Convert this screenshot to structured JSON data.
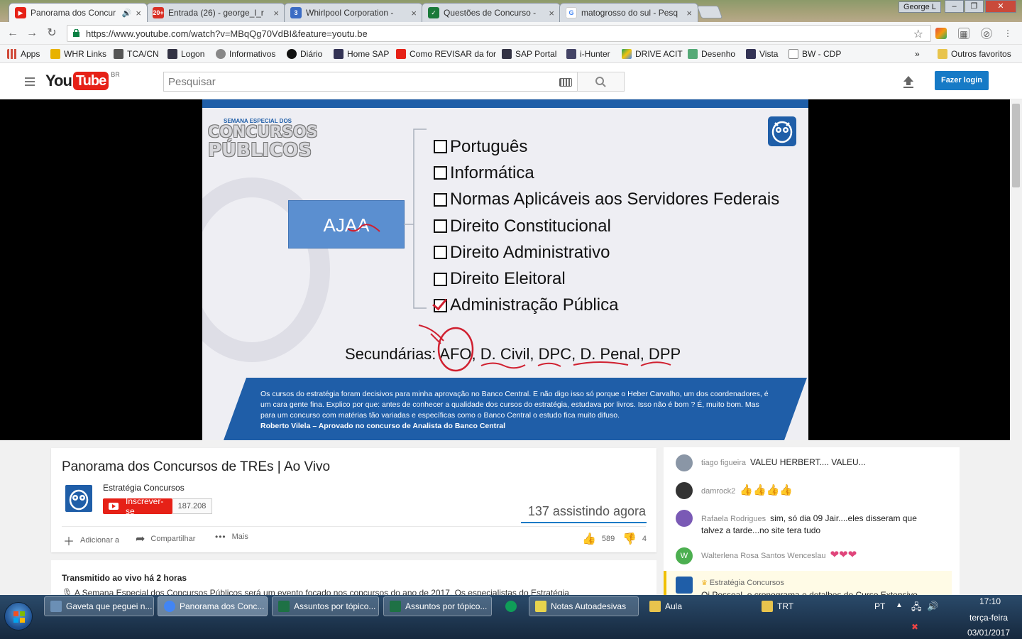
{
  "browser": {
    "tabs": [
      {
        "title": "Panorama dos Concur",
        "active": true,
        "favicon": "youtube-icon",
        "color": "#e62117"
      },
      {
        "title": "Entrada (26) - george_l_r",
        "favicon": "gmail-icon",
        "color": "#d93025",
        "badge": "20+"
      },
      {
        "title": "Whirlpool Corporation -",
        "favicon": "doc-icon",
        "color": "#3b6cc4",
        "badge": "3"
      },
      {
        "title": "Questões de Concurso -",
        "favicon": "check-icon",
        "color": "#1a7a3a"
      },
      {
        "title": "matogrosso do sul - Pesq",
        "favicon": "google-icon",
        "color": "#4285f4"
      }
    ],
    "window_user": "George L",
    "url": "https://www.youtube.com/watch?v=MBqQg70VdBI&feature=youtu.be",
    "bookmarks": [
      {
        "label": "Apps",
        "color": "#d04a3a"
      },
      {
        "label": "WHR Links",
        "color": "#e8b200"
      },
      {
        "label": "TCA/CN",
        "color": "#444"
      },
      {
        "label": "Logon",
        "color": "#223"
      },
      {
        "label": "Informativos",
        "color": "#777"
      },
      {
        "label": "Diário",
        "color": "#111"
      },
      {
        "label": "Home SAP",
        "color": "#225"
      },
      {
        "label": "Como REVISAR da for",
        "color": "#e62117"
      },
      {
        "label": "SAP Portal",
        "color": "#223"
      },
      {
        "label": "i-Hunter",
        "color": "#335"
      },
      {
        "label": "DRIVE ACIT",
        "color": "#1aa260"
      },
      {
        "label": "Desenho",
        "color": "#4a6"
      },
      {
        "label": "Vista",
        "color": "#225"
      },
      {
        "label": "BW - CDP",
        "color": "#888"
      }
    ],
    "bookmarks_more": "»",
    "other_bookmarks": "Outros favoritos"
  },
  "youtube": {
    "logo_you": "You",
    "logo_tube": "Tube",
    "region": "BR",
    "search_placeholder": "Pesquisar",
    "login_label": "Fazer login"
  },
  "slide": {
    "badge_line1": "SEMANA ESPECIAL DOS",
    "badge_line2": "CONCURSOS",
    "badge_line3": "PÚBLICOS",
    "box_label": "AJAA",
    "subjects": [
      {
        "label": "Português",
        "checked": false
      },
      {
        "label": "Informática",
        "checked": false
      },
      {
        "label": "Normas Aplicáveis aos Servidores Federais",
        "checked": false
      },
      {
        "label": "Direito Constitucional",
        "checked": false
      },
      {
        "label": "Direito Administrativo",
        "checked": false
      },
      {
        "label": "Direito Eleitoral",
        "checked": false
      },
      {
        "label": "Administração Pública",
        "checked": true
      }
    ],
    "secondary": "Secundárias: AFO, D. Civil, DPC, D. Penal, DPP",
    "quote": "Os cursos do estratégia foram decisivos para minha aprovação no Banco Central. E não digo isso só porque o Heber Carvalho, um dos coordenadores, é um cara gente fina. Explico por que: antes de conhecer a qualidade dos cursos do estratégia, estudava por livros. Isso não é bom ? É, muito bom. Mas para um concurso com matérias tão variadas e específicas como o Banco Central o estudo fica muito difuso.",
    "quote_author": "Roberto Vilela – Aprovado no concurso de Analista do Banco Central"
  },
  "video": {
    "title": "Panorama dos Concursos de TREs | Ao Vivo",
    "channel": "Estratégia Concursos",
    "subscribe_label": "Inscrever-se",
    "subscriber_count": "187.208",
    "watching": "137 assistindo agora",
    "add_label": "Adicionar a",
    "share_label": "Compartilhar",
    "more_label": "Mais",
    "likes": "589",
    "dislikes": "4",
    "streamed": "Transmitido ao vivo há 2 horas",
    "description": "A Semana Especial dos Concursos Públicos será um evento focado nos concursos do ano de 2017. Os especialistas do Estratégia"
  },
  "chat": [
    {
      "author": "tiago figueira",
      "text": "VALEU HERBERT.... VALEU...",
      "avatar_color": "#8a96a6"
    },
    {
      "author": "damrock2",
      "text": "",
      "emoji": "👍👍👍👍",
      "avatar_color": "#333"
    },
    {
      "author": "Rafaela Rodrigues",
      "text": "sim, só dia 09 Jair....eles disseram que talvez a tarde...no site tera tudo",
      "avatar_color": "#7a5ab5"
    },
    {
      "author": "Walterlena Rosa Santos Wenceslau",
      "text": "",
      "emoji": "❤❤❤",
      "avatar_color": "#4caf50",
      "initial": "W"
    },
    {
      "author": "Estratégia Concursos",
      "text": "Oi Pessoal, o cronograma e detalhes do Curso Extensivo",
      "avatar_color": "#1f5ea8",
      "owner": true
    }
  ],
  "taskbar": {
    "items": [
      {
        "label": "Gaveta que peguei n...",
        "color": "#6b8fb5"
      },
      {
        "label": "Panorama dos Conc...",
        "color": "#4285f4",
        "active": true
      },
      {
        "label": "Assuntos por tópico...",
        "color": "#1e7145"
      },
      {
        "label": "Assuntos por tópico...",
        "color": "#1e7145"
      },
      {
        "label": "",
        "color": "#0f9d58"
      },
      {
        "label": "Notas Autoadesivas",
        "color": "#e8d44d"
      },
      {
        "label": "Aula",
        "color": "#e8c44d"
      },
      {
        "label": "TRT",
        "color": "#e8c44d"
      }
    ],
    "lang": "PT",
    "time": "17:10",
    "day": "terça-feira",
    "date": "03/01/2017"
  }
}
